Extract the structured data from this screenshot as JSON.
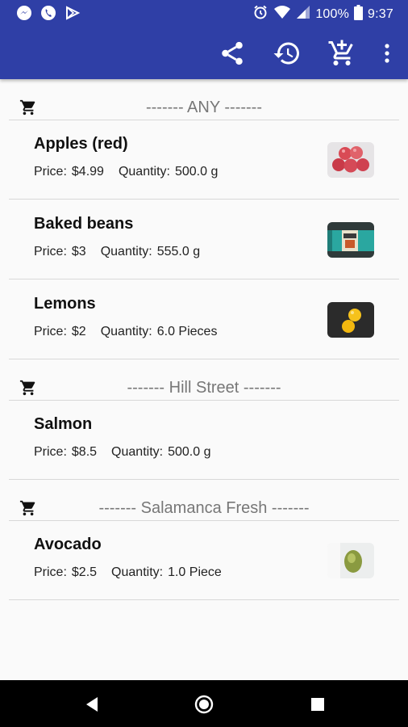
{
  "status_bar": {
    "left_icons": [
      "messenger-icon",
      "phone-icon",
      "play-store-icon"
    ],
    "battery_percent": "100%",
    "time": "9:37"
  },
  "app_bar": {
    "actions": [
      "share-icon",
      "history-icon",
      "add-to-cart-icon",
      "overflow-menu-icon"
    ]
  },
  "sections": [
    {
      "title": "------- ANY -------",
      "items": [
        {
          "name": "Apples (red)",
          "price_label": "Price:",
          "price": "$4.99",
          "qty_label": "Quantity:",
          "qty": "500.0 g",
          "thumb": "apples"
        },
        {
          "name": "Baked beans",
          "price_label": "Price:",
          "price": "$3",
          "qty_label": "Quantity:",
          "qty": "555.0 g",
          "thumb": "beans"
        },
        {
          "name": "Lemons",
          "price_label": "Price:",
          "price": "$2",
          "qty_label": "Quantity:",
          "qty": "6.0 Pieces",
          "thumb": "lemons"
        }
      ]
    },
    {
      "title": "------- Hill Street -------",
      "items": [
        {
          "name": "Salmon",
          "price_label": "Price:",
          "price": "$8.5",
          "qty_label": "Quantity:",
          "qty": "500.0 g",
          "thumb": ""
        }
      ]
    },
    {
      "title": "------- Salamanca Fresh -------",
      "items": [
        {
          "name": "Avocado",
          "price_label": "Price:",
          "price": "$2.5",
          "qty_label": "Quantity:",
          "qty": "1.0 Piece",
          "thumb": "avocado"
        }
      ]
    }
  ],
  "colors": {
    "app_bar": "#2f3fa6",
    "background": "#fafafa",
    "divider": "#d8d8d8",
    "section_title": "#777777"
  }
}
